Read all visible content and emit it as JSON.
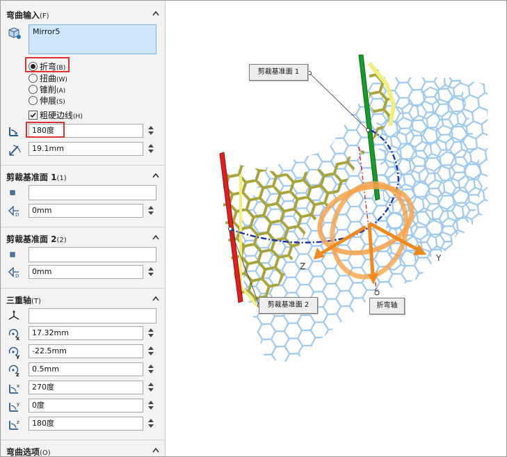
{
  "flex_input": {
    "title": "弯曲输入",
    "shortcut": "(F)",
    "selection_value": "Mirror5",
    "options": [
      {
        "label": "折弯",
        "key": "(B)",
        "selected": true
      },
      {
        "label": "扭曲",
        "key": "(W)",
        "selected": false
      },
      {
        "label": "锥削",
        "key": "(A)",
        "selected": false
      },
      {
        "label": "伸展",
        "key": "(S)",
        "selected": false
      }
    ],
    "hard_edges_label": "粗硬边线",
    "hard_edges_key": "(H)",
    "hard_edges_checked": true,
    "angle_value": "180度",
    "radius_value": "19.1mm"
  },
  "trim_plane_1": {
    "title": "剪裁基准面 1",
    "shortcut": "(1)",
    "selection_value": "",
    "distance_value": "0mm"
  },
  "trim_plane_2": {
    "title": "剪裁基准面 2",
    "shortcut": "(2)",
    "selection_value": "",
    "distance_value": "0mm"
  },
  "triad": {
    "title": "三重轴",
    "shortcut": "(T)",
    "selection_value": "",
    "x_value": "17.32mm",
    "y_value": "-22.5mm",
    "z_value": "0.5mm",
    "rot_x_value": "270度",
    "rot_y_value": "0度",
    "rot_z_value": "180度"
  },
  "flex_options": {
    "title": "弯曲选项",
    "shortcut": "(O)"
  },
  "viewport": {
    "callout_trim_1": "剪裁基准面 1",
    "callout_trim_2": "剪裁基准面 2",
    "callout_bend_axis": "折弯轴",
    "axis_z": "Z",
    "axis_y": "Y",
    "axis_x": "X"
  },
  "colors": {
    "highlight_red": "#e03131",
    "selection_blue": "#cfe5fb",
    "mesh_blue": "#9cc8ef",
    "mesh_yellow": "#e9e23e",
    "plane_red": "#e02020",
    "plane_green": "#1a9a2a",
    "triad_orange": "#f5a24a",
    "axis_blue": "#1a2fb5"
  }
}
